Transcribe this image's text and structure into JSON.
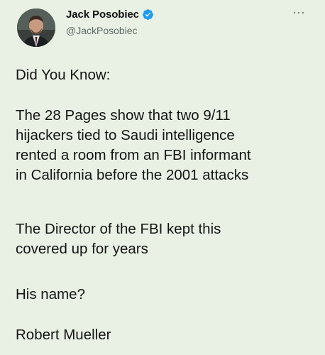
{
  "tweet": {
    "author": {
      "display_name": "Jack Posobiec",
      "handle": "@JackPosobiec",
      "verified": true
    },
    "more_menu_icon": "more-horizontal-icon",
    "paragraphs": [
      "Did You Know:",
      "The 28 Pages show that two 9/11\nhijackers tied to Saudi intelligence\nrented a room from an FBI informant\nin California before the 2001 attacks",
      "The Director of the FBI kept this\ncovered up for years",
      "His name?",
      "Robert Mueller"
    ]
  },
  "colors": {
    "background": "#e9f1e4",
    "text": "#151515",
    "handle": "#5e6a63",
    "verified_badge": "#1d9bf0"
  }
}
